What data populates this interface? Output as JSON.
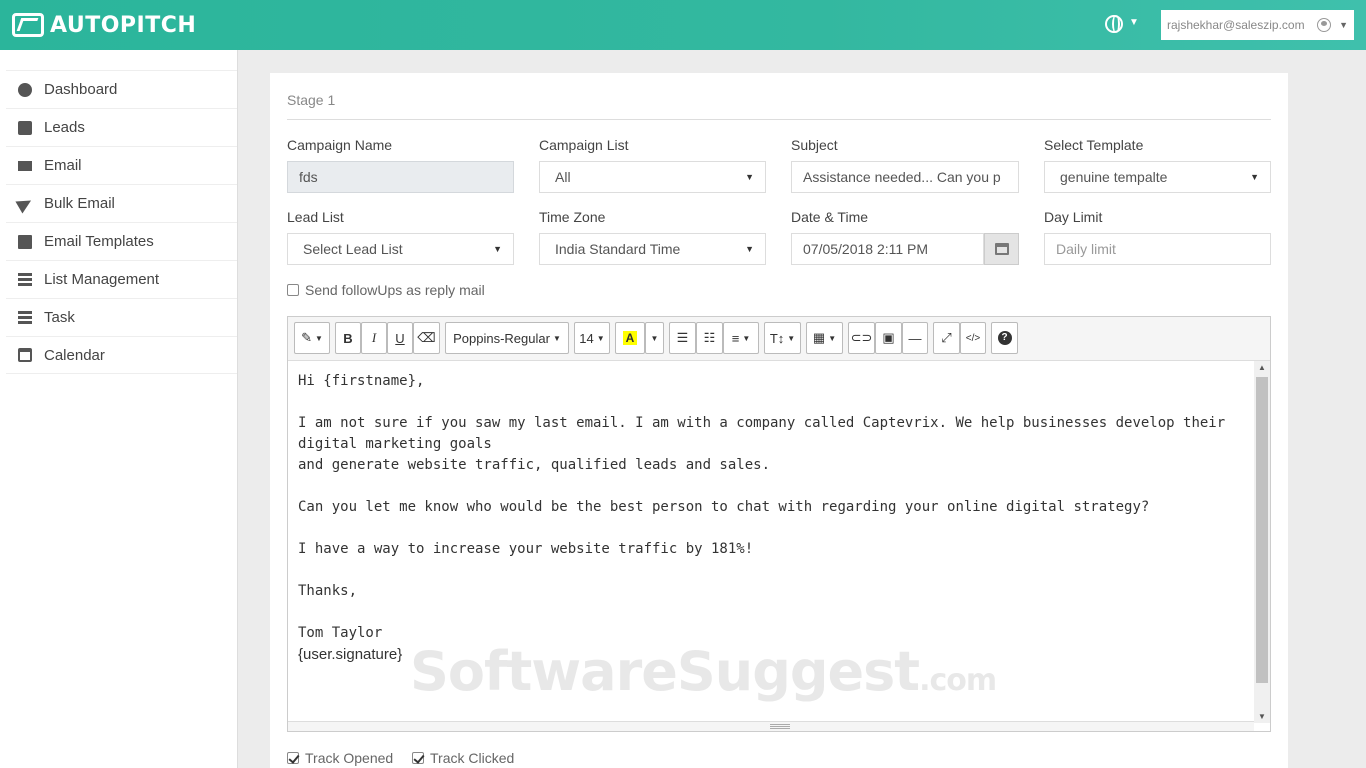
{
  "header": {
    "brand": "AUTOPITCH",
    "user_email": "rajshekhar@saleszip.com"
  },
  "sidebar": {
    "items": [
      {
        "label": "Dashboard",
        "icon": "dashboard-icon"
      },
      {
        "label": "Leads",
        "icon": "leads-icon"
      },
      {
        "label": "Email",
        "icon": "envelope-icon"
      },
      {
        "label": "Bulk Email",
        "icon": "paper-plane-icon"
      },
      {
        "label": "Email Templates",
        "icon": "template-icon"
      },
      {
        "label": "List Management",
        "icon": "list-icon"
      },
      {
        "label": "Task",
        "icon": "task-icon"
      },
      {
        "label": "Calendar",
        "icon": "calendar-icon"
      }
    ]
  },
  "form": {
    "stage": "Stage 1",
    "campaign_name_label": "Campaign Name",
    "campaign_name_value": "fds",
    "campaign_list_label": "Campaign List",
    "campaign_list_value": "All",
    "subject_label": "Subject",
    "subject_value": "Assistance needed... Can you p",
    "template_label": "Select Template",
    "template_value": "genuine tempalte",
    "lead_list_label": "Lead List",
    "lead_list_value": "Select Lead List",
    "timezone_label": "Time Zone",
    "timezone_value": "India Standard Time",
    "datetime_label": "Date & Time",
    "datetime_value": "07/05/2018 2:11 PM",
    "day_limit_label": "Day Limit",
    "day_limit_placeholder": "Daily limit",
    "followup_label": "Send followUps as reply mail",
    "track_opened_label": "Track Opened",
    "track_clicked_label": "Track Clicked"
  },
  "toolbar": {
    "font_name": "Poppins-Regular",
    "font_size": "14",
    "bold": "B",
    "italic": "I",
    "underline": "U",
    "highlight": "A",
    "text_height": "T↕",
    "help": "?"
  },
  "editor": {
    "lines": [
      "Hi {firstname},",
      "",
      "I am not sure if you saw my last email. I am with a company called Captevrix. We help businesses develop their digital marketing goals",
      "and generate website traffic, qualified leads and sales.",
      "",
      "Can you let me know who would be the best person to chat with regarding your online digital strategy?",
      "",
      "I have a way to increase your website traffic by 181%!",
      "",
      "Thanks,",
      "",
      "Tom Taylor"
    ],
    "signature": "{user.signature}"
  },
  "watermark": {
    "main": "SoftwareSuggest",
    "suffix": ".com"
  },
  "colors": {
    "header_teal": "#2bb59b",
    "highlight_yellow": "#ffff00"
  }
}
